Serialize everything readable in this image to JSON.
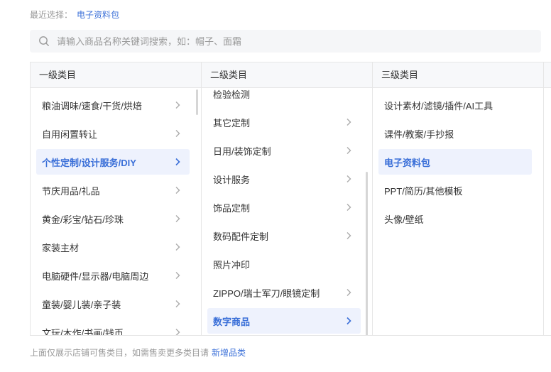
{
  "recent": {
    "label": "最近选择：",
    "value": "电子资料包"
  },
  "search": {
    "placeholder": "请输入商品名称关键词搜索，如：帽子、面霜",
    "icon": "search-icon"
  },
  "columns": {
    "level1": {
      "header": "一级类目",
      "items": [
        {
          "label": "粮油调味/速食/干货/烘焙"
        },
        {
          "label": "自用闲置转让"
        },
        {
          "label": "个性定制/设计服务/DIY"
        },
        {
          "label": "节庆用品/礼品"
        },
        {
          "label": "黄金/彩宝/钻石/珍珠"
        },
        {
          "label": "家装主材"
        },
        {
          "label": "电脑硬件/显示器/电脑周边"
        },
        {
          "label": "童装/婴儿装/亲子装"
        },
        {
          "label": "文玩/木作/书画/钱币"
        }
      ],
      "selected": "个性定制/设计服务/DIY"
    },
    "level2": {
      "header": "二级类目",
      "items": [
        {
          "label": "检验检测"
        },
        {
          "label": "其它定制"
        },
        {
          "label": "日用/装饰定制"
        },
        {
          "label": "设计服务"
        },
        {
          "label": "饰品定制"
        },
        {
          "label": "数码配件定制"
        },
        {
          "label": "照片冲印"
        },
        {
          "label": "ZIPPO/瑞士军刀/眼镜定制"
        },
        {
          "label": "数字商品"
        }
      ],
      "selected": "数字商品"
    },
    "level3": {
      "header": "三级类目",
      "items": [
        {
          "label": "设计素材/滤镜/插件/AI工具"
        },
        {
          "label": "课件/教案/手抄报"
        },
        {
          "label": "电子资料包"
        },
        {
          "label": "PPT/简历/其他模板"
        },
        {
          "label": "头像/壁纸"
        }
      ],
      "selected": "电子资料包"
    }
  },
  "footer": {
    "text": "上面仅展示店铺可售类目，如需售卖更多类目请",
    "link": "新增品类"
  },
  "colors": {
    "accent": "#3a6fd8",
    "active_bg": "#eef2fd",
    "border": "#e6e6e6",
    "muted": "#999999"
  }
}
